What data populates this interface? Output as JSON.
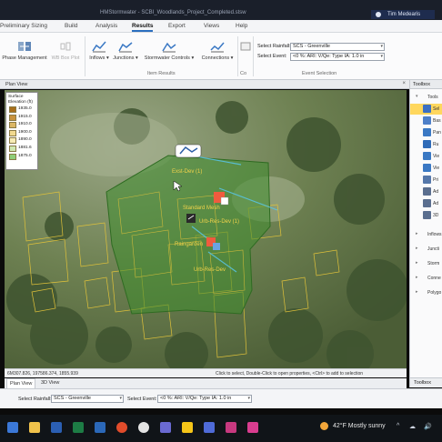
{
  "window": {
    "title": "HMStormwater - SCBI_Woodlands_Project_Completed.stsw"
  },
  "user": {
    "name": "Tim Medearis"
  },
  "ribbon_tabs": [
    {
      "label": "Preliminary Sizing"
    },
    {
      "label": "Build"
    },
    {
      "label": "Analysis"
    },
    {
      "label": "Results"
    },
    {
      "label": "Export"
    },
    {
      "label": "Views"
    },
    {
      "label": "Help"
    }
  ],
  "ribbon": {
    "phase_management": "Phase Management",
    "wb_box_plot": "WB Box Plot",
    "inflows": "Inflows",
    "junctions": "Junctions",
    "stormwater_controls": "Stormwater Controls",
    "connections": "Connections",
    "group_item_results": "Item Results",
    "group_co": "Co",
    "group_event_selection": "Event Selection",
    "select_rainfall_label": "Select Rainfall:",
    "select_event_label": "Select Event:",
    "rainfall_value": "SCS - Greenville",
    "event_value": "<0 %: ARI: V/Qe: Type IA: 1.0 in"
  },
  "plan_view": {
    "title": "Plan View"
  },
  "legend": {
    "title_line1": "Surface",
    "title_line2": "Elevation (ft)",
    "items": [
      {
        "label": "1935.0",
        "color": "#a86f1c"
      },
      {
        "label": "1915.0",
        "color": "#c8923d"
      },
      {
        "label": "1910.0",
        "color": "#dcb765"
      },
      {
        "label": "1900.0",
        "color": "#f1d98f"
      },
      {
        "label": "1890.0",
        "color": "#f7ebb5"
      },
      {
        "label": "1881.6",
        "color": "#cfe8b1"
      },
      {
        "label": "1875.0",
        "color": "#8fce79"
      }
    ]
  },
  "map_labels": {
    "label_1": "Exst-Dev (1)",
    "label_2": "Standard Mesh",
    "label_3": "Urb-Res-Dev (1)",
    "label_4": "Raingarden",
    "label_5": "Urb-Res-Dev"
  },
  "status": {
    "coords": "6M307.826, 197586.374, 1855.939",
    "hint": "Click to select, Double-Click to open properties, <Ctrl> to add to selection"
  },
  "view_tabs": [
    {
      "label": "Plan View"
    },
    {
      "label": "3D View"
    }
  ],
  "toolbox": {
    "title": "Toolbox",
    "items": [
      {
        "label": "Tools",
        "icon": "tools-icon"
      },
      {
        "label": "Sel",
        "icon": "select-arrow-icon"
      },
      {
        "label": "Bas",
        "icon": "basemap-icon"
      },
      {
        "label": "Pan",
        "icon": "pan-icon"
      },
      {
        "label": "Ru",
        "icon": "ruler-icon"
      },
      {
        "label": "Vie",
        "icon": "view-icon"
      },
      {
        "label": "Vie",
        "icon": "view-icon"
      },
      {
        "label": "Pri",
        "icon": "print-icon"
      },
      {
        "label": "Ad",
        "icon": "add-link-icon"
      },
      {
        "label": "Ad",
        "icon": "add-node-icon"
      },
      {
        "label": "3D",
        "icon": "3d-icon"
      },
      {
        "label": "Inflows",
        "icon": "inflows-icon"
      },
      {
        "label": "Juncti",
        "icon": "junctions-icon"
      },
      {
        "label": "Storm",
        "icon": "stormwater-icon"
      },
      {
        "label": "Conne",
        "icon": "connections-icon"
      },
      {
        "label": "Polygo",
        "icon": "polygon-icon"
      }
    ],
    "footer_tab": "Toolbox"
  },
  "bottom_bar": {
    "select_rainfall_label": "Select Rainfall:",
    "rainfall_value": "SCS - Greenville",
    "select_event_label": "Select Event:",
    "event_value": "<0 %: ARI: V/Qe: Type IA: 1.0 in"
  },
  "taskbar": {
    "weather": "42°F  Mostly sunny",
    "tray": [
      "^",
      "☁",
      "🔊"
    ]
  },
  "colors": {
    "accent": "#2b6fbf",
    "catchment_fill": "#3e8c2e",
    "parcel_outline": "#e0c23a",
    "selection": "#ffd75e"
  }
}
